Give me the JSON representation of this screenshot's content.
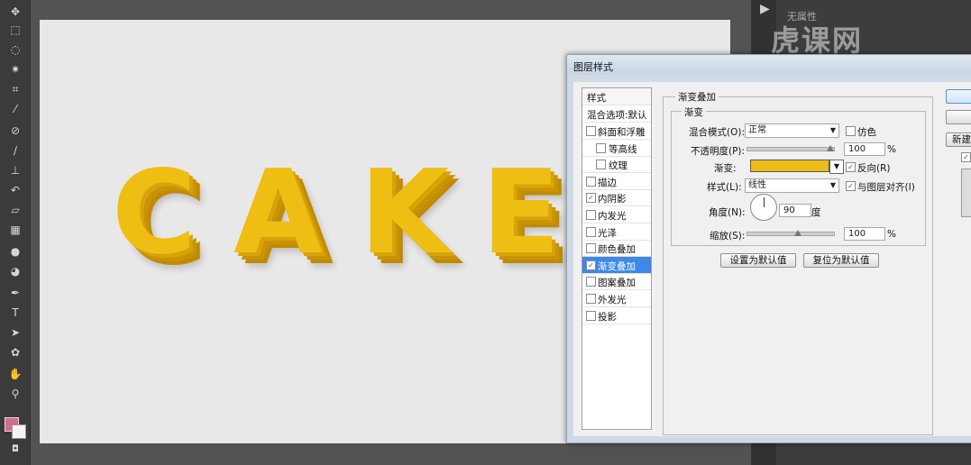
{
  "toolbar": {
    "tools": [
      "move-icon",
      "marquee-icon",
      "lasso-icon",
      "magic-wand-icon",
      "crop-icon",
      "eyedropper-icon",
      "healing-brush-icon",
      "brush-icon",
      "clone-stamp-icon",
      "history-brush-icon",
      "eraser-icon",
      "gradient-icon",
      "blur-icon",
      "dodge-icon",
      "pen-icon",
      "type-icon",
      "path-select-icon",
      "shape-icon",
      "hand-icon",
      "zoom-icon"
    ],
    "type_tool_label": "T",
    "foreground_color": "#d36c8e",
    "background_color": "#f4f4f4"
  },
  "canvas": {
    "letters": [
      "C",
      "A",
      "K",
      "E"
    ],
    "text_color": "#efbe13"
  },
  "right_panel": {
    "no_properties": "无属性",
    "watermark": "虎课网"
  },
  "dialog": {
    "title": "图层样式",
    "styles_header": "样式",
    "blend_options": "混合选项:默认",
    "items": [
      {
        "label": "斜面和浮雕",
        "checked": false,
        "indent": false
      },
      {
        "label": "等高线",
        "checked": false,
        "indent": true
      },
      {
        "label": "纹理",
        "checked": false,
        "indent": true
      },
      {
        "label": "描边",
        "checked": false,
        "indent": false
      },
      {
        "label": "内阴影",
        "checked": true,
        "indent": false
      },
      {
        "label": "内发光",
        "checked": false,
        "indent": false
      },
      {
        "label": "光泽",
        "checked": false,
        "indent": false
      },
      {
        "label": "颜色叠加",
        "checked": false,
        "indent": false
      },
      {
        "label": "渐变叠加",
        "checked": true,
        "indent": false,
        "selected": true
      },
      {
        "label": "图案叠加",
        "checked": false,
        "indent": false
      },
      {
        "label": "外发光",
        "checked": false,
        "indent": false
      },
      {
        "label": "投影",
        "checked": false,
        "indent": false
      }
    ],
    "section_title": "渐变叠加",
    "subsection_title": "渐变",
    "blend_mode_label": "混合模式(O):",
    "blend_mode_value": "正常",
    "dither_label": "仿色",
    "dither_checked": false,
    "opacity_label": "不透明度(P):",
    "opacity_value": "100",
    "opacity_unit": "%",
    "gradient_label": "渐变:",
    "gradient_color": "#ecbb17",
    "reverse_label": "反向(R)",
    "reverse_checked": true,
    "style_label": "样式(L):",
    "style_value": "线性",
    "align_label": "与图层对齐(I)",
    "align_checked": true,
    "angle_label": "角度(N):",
    "angle_value": "90",
    "angle_unit": "度",
    "scale_label": "缩放(S):",
    "scale_value": "100",
    "scale_unit": "%",
    "set_default_button": "设置为默认值",
    "reset_default_button": "复位为默认值",
    "new_style_button": "新建",
    "checked_mark": "✓",
    "dropdown_arrow": "▼"
  }
}
